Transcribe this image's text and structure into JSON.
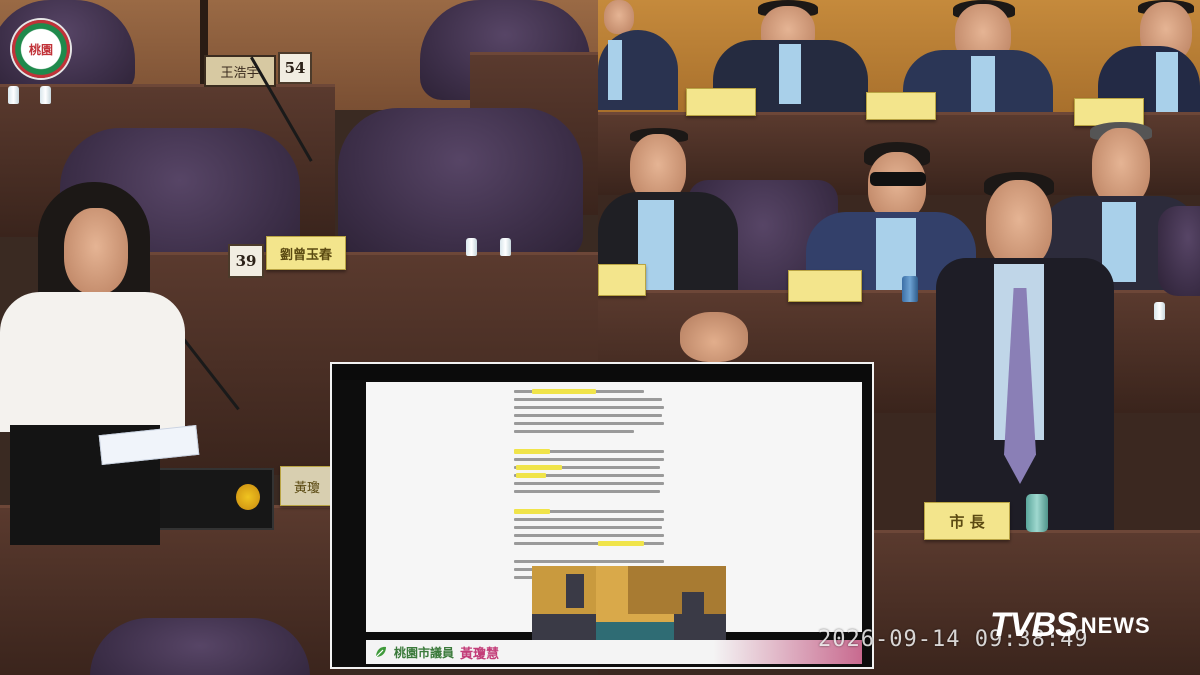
{
  "emblem": {
    "text": "桃園",
    "icon": "city-emblem-icon"
  },
  "left_desk_labels": {
    "seat_54": "54",
    "seat_39": "39",
    "nameplate_top": "王浩宇",
    "nameplate_middle": "劉曾玉春",
    "nameplate_front": "黃瓊"
  },
  "right_desk_labels": {
    "mayor_plate": "市 長"
  },
  "slide": {
    "banner_label": "桃園市議員",
    "banner_name": "黃瓊慧"
  },
  "overlay": {
    "timestamp": "2026-09-14 09:38:49",
    "brand_main": "TVBS",
    "brand_sub": "NEWS"
  },
  "colors": {
    "plate_yellow": "#f3e58c",
    "slide_highlight": "#f0e44a",
    "banner_pink": "#c86a8f",
    "seat_purple": "#574566"
  }
}
